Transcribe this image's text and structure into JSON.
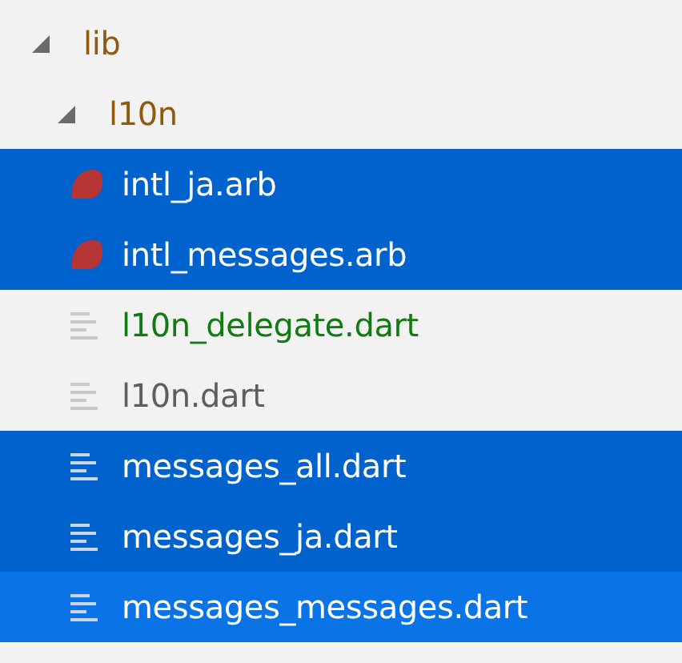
{
  "tree": [
    {
      "name": "lib",
      "kind": "folder",
      "expanded": true,
      "selected": false,
      "color": "#8f5a0c",
      "children": [
        {
          "name": "l10n",
          "kind": "folder",
          "expanded": true,
          "selected": false,
          "color": "#8f5a0c",
          "children": [
            {
              "name": "intl_ja.arb",
              "kind": "arb",
              "selected": true,
              "focused": false
            },
            {
              "name": "intl_messages.arb",
              "kind": "arb",
              "selected": true,
              "focused": false
            },
            {
              "name": "l10n_delegate.dart",
              "kind": "dart",
              "selected": false,
              "color": "#127a12"
            },
            {
              "name": "l10n.dart",
              "kind": "dart",
              "selected": false,
              "color": "#5e5e5e"
            },
            {
              "name": "messages_all.dart",
              "kind": "dart",
              "selected": true,
              "focused": false
            },
            {
              "name": "messages_ja.dart",
              "kind": "dart",
              "selected": true,
              "focused": false
            },
            {
              "name": "messages_messages.dart",
              "kind": "dart",
              "selected": true,
              "focused": true
            }
          ]
        }
      ]
    }
  ]
}
